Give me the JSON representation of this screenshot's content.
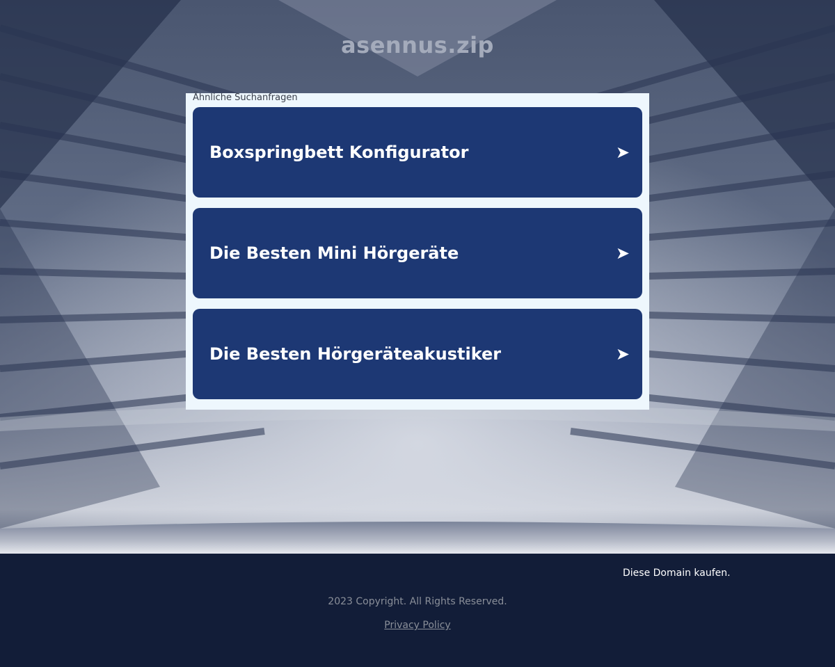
{
  "site": {
    "title": "asennus.zip"
  },
  "related": {
    "heading": "Ähnliche Suchanfragen",
    "items": [
      {
        "label": "Boxspringbett Konfigurator",
        "arrow": "➤"
      },
      {
        "label": "Die Besten Mini Hörgeräte",
        "arrow": "➤"
      },
      {
        "label": "Die Besten Hörgeräteakustiker",
        "arrow": "➤"
      }
    ]
  },
  "footer": {
    "buy_domain": "Diese Domain kaufen.",
    "copyright": "2023 Copyright. All Rights Reserved.",
    "privacy": "Privacy Policy "
  },
  "colors": {
    "result_bg": "#1d3874",
    "panel_bg": "#eef7fd",
    "footer_bg": "#121d38"
  }
}
